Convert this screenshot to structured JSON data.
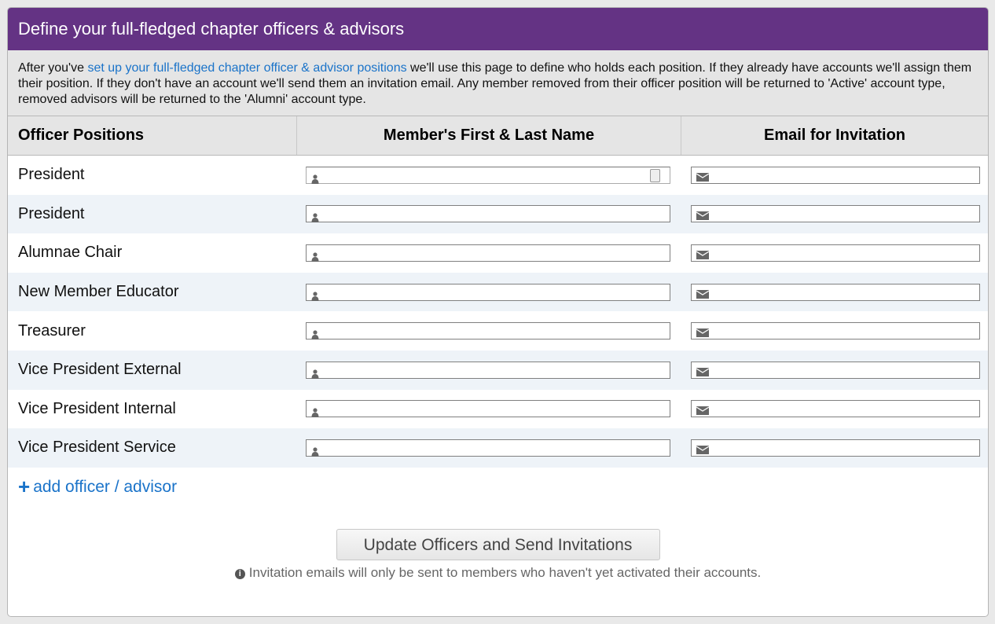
{
  "title": "Define your full-fledged chapter officers & advisors",
  "description": {
    "before": "After you've ",
    "link": "set up your full-fledged chapter officer & advisor positions",
    "after": " we'll use this page to define who holds each position. If they already have accounts we'll assign them their position. If they don't have an account we'll send them an invitation email. Any member removed from their officer position will be returned to 'Active' account type, removed advisors will be returned to the 'Alumni' account type."
  },
  "columns": [
    "Officer Positions",
    "Member's First & Last Name",
    "Email for Invitation"
  ],
  "rows": [
    {
      "position": "President",
      "name": "",
      "email": ""
    },
    {
      "position": "President",
      "name": "",
      "email": ""
    },
    {
      "position": "Alumnae Chair",
      "name": "",
      "email": ""
    },
    {
      "position": "New Member Educator",
      "name": "",
      "email": ""
    },
    {
      "position": "Treasurer",
      "name": "",
      "email": ""
    },
    {
      "position": "Vice President External",
      "name": "",
      "email": ""
    },
    {
      "position": "Vice President Internal",
      "name": "",
      "email": ""
    },
    {
      "position": "Vice President Service",
      "name": "",
      "email": ""
    }
  ],
  "add_label": "add officer / advisor",
  "submit_label": "Update Officers and Send Invitations",
  "note": "Invitation emails will only be sent to members who haven't yet activated their accounts.",
  "colors": {
    "header": "#643384",
    "link": "#1a73c9"
  }
}
